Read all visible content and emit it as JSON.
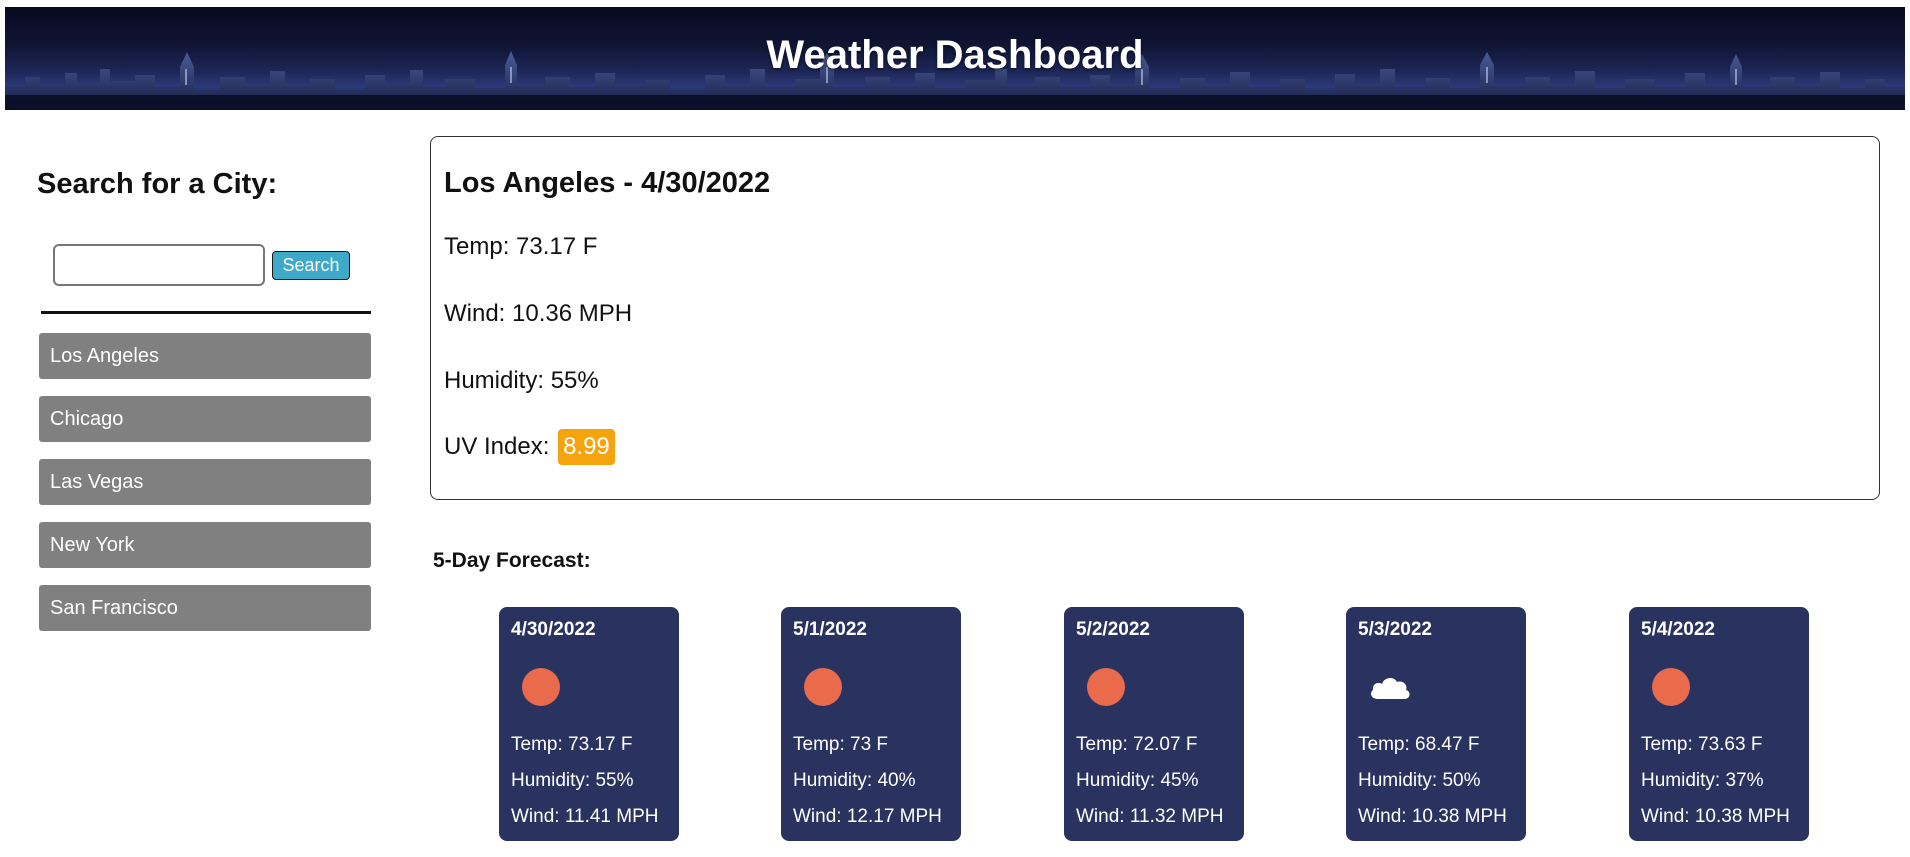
{
  "header": {
    "title": "Weather Dashboard"
  },
  "sidebar": {
    "heading": "Search for a City:",
    "search": {
      "value": "",
      "placeholder": "",
      "button_label": "Search"
    },
    "history": [
      "Los Angeles",
      "Chicago",
      "Las Vegas",
      "New York",
      "San Francisco"
    ]
  },
  "current": {
    "title": "Los Angeles - 4/30/2022",
    "temp": "Temp: 73.17 F",
    "wind": "Wind: 10.36 MPH",
    "humidity": "Humidity: 55%",
    "uv_label": "UV Index:",
    "uv_value": "8.99",
    "uv_color": "#f6a40d"
  },
  "forecast": {
    "title": "5-Day Forecast:",
    "days": [
      {
        "date": "4/30/2022",
        "icon": "sun-icon",
        "temp": "Temp: 73.17 F",
        "humidity": "Humidity: 55%",
        "wind": "Wind: 11.41 MPH"
      },
      {
        "date": "5/1/2022",
        "icon": "sun-icon",
        "temp": "Temp: 73 F",
        "humidity": "Humidity: 40%",
        "wind": "Wind: 12.17 MPH"
      },
      {
        "date": "5/2/2022",
        "icon": "sun-icon",
        "temp": "Temp: 72.07 F",
        "humidity": "Humidity: 45%",
        "wind": "Wind: 11.32 MPH"
      },
      {
        "date": "5/3/2022",
        "icon": "cloud-icon",
        "temp": "Temp: 68.47 F",
        "humidity": "Humidity: 50%",
        "wind": "Wind: 10.38 MPH"
      },
      {
        "date": "5/4/2022",
        "icon": "sun-icon",
        "temp": "Temp: 73.63 F",
        "humidity": "Humidity: 37%",
        "wind": "Wind: 10.38 MPH"
      }
    ]
  },
  "colors": {
    "card_bg": "#2a3360",
    "sun": "#e96b4c",
    "city_button": "#808080",
    "search_button": "#3ea9c9"
  }
}
